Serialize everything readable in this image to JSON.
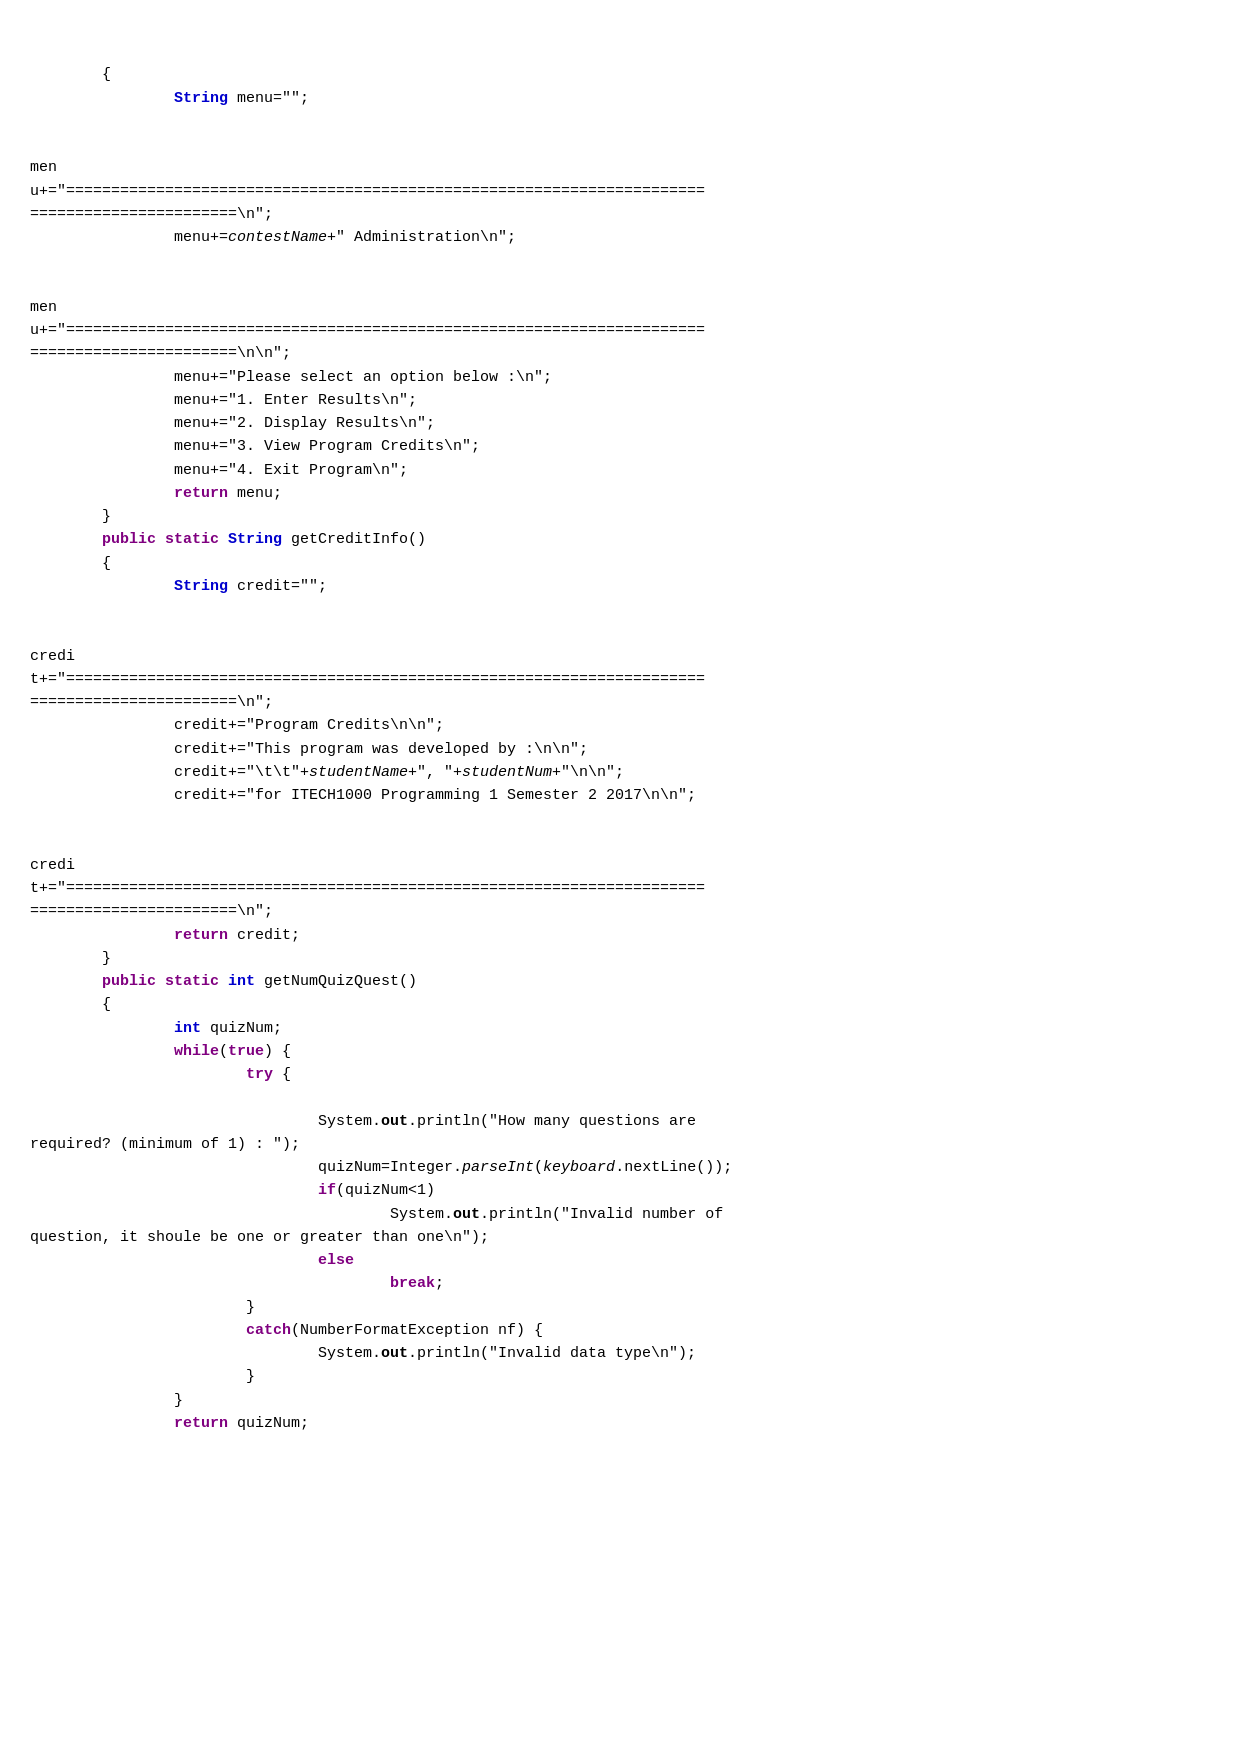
{
  "code": {
    "lines": []
  }
}
